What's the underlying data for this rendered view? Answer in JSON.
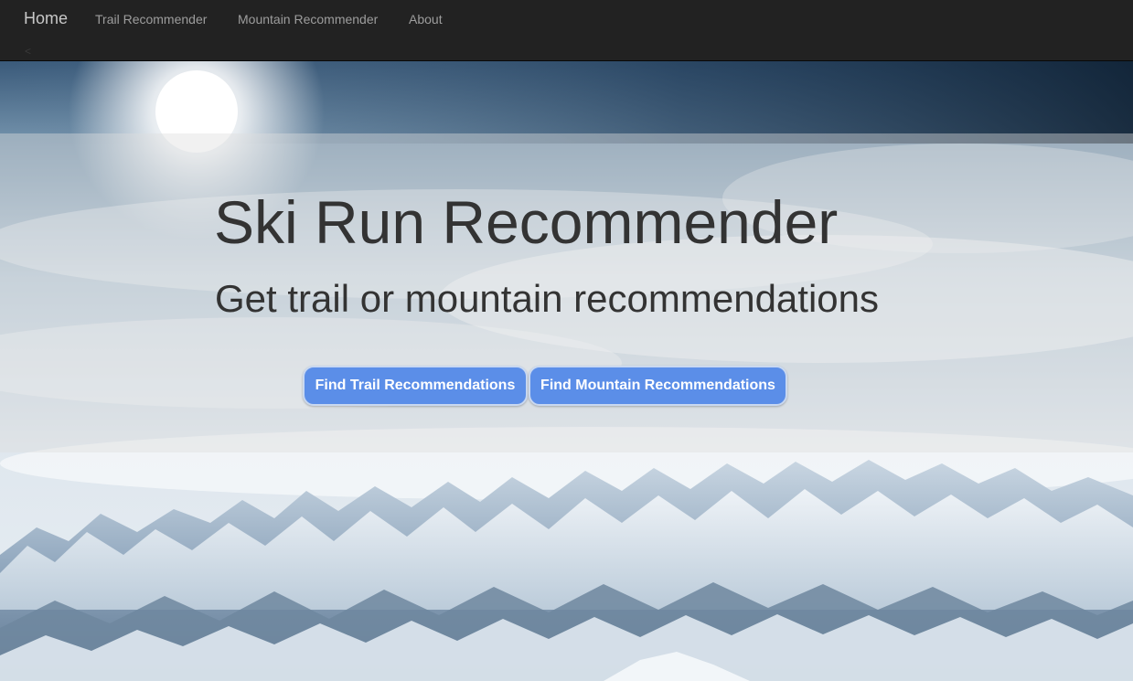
{
  "navbar": {
    "brand": "Home",
    "links": [
      {
        "label": "Trail Recommender"
      },
      {
        "label": "Mountain Recommender"
      },
      {
        "label": "About"
      }
    ]
  },
  "hero": {
    "title": "Ski Run Recommender",
    "subtitle": "Get trail or mountain recommendations",
    "buttons": [
      {
        "label": "Find Trail Recommendations"
      },
      {
        "label": "Find Mountain Recommendations"
      }
    ],
    "background_image": "snowy-mountain-range-photo"
  },
  "colors": {
    "navbar_bg": "#222222",
    "button_bg": "#5b8ee8",
    "heading_text": "#333333"
  }
}
